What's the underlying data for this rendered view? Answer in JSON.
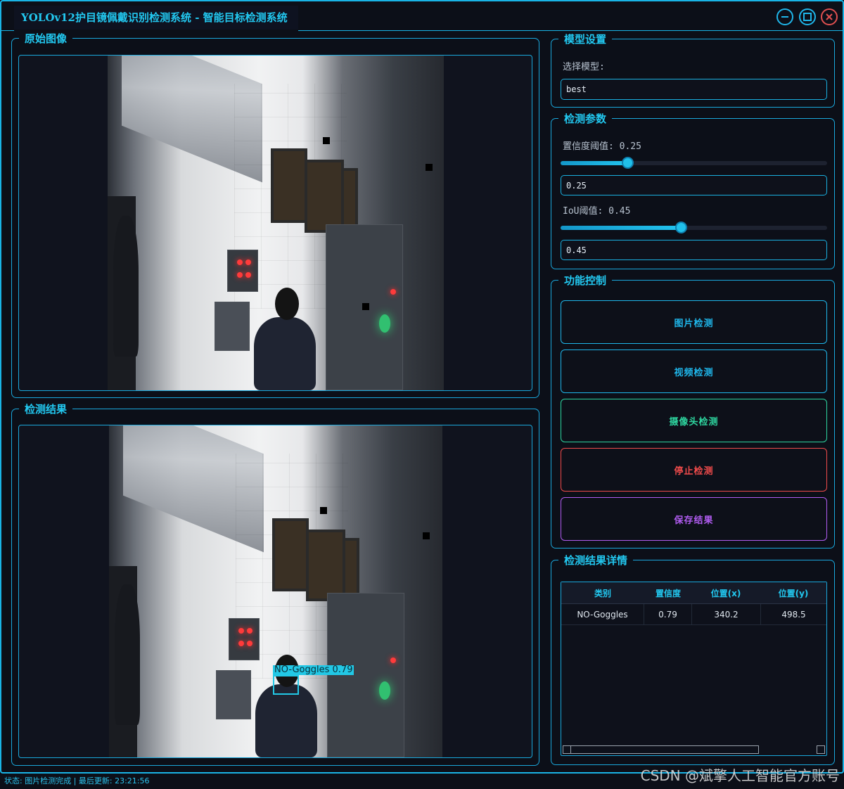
{
  "window": {
    "title": "YOLOv12护目镜佩戴识别检测系统 - 智能目标检测系统"
  },
  "original_panel": {
    "title": "原始图像"
  },
  "result_panel": {
    "title": "检测结果",
    "detection_label": "NO-Goggles 0.79"
  },
  "model_settings": {
    "title": "模型设置",
    "select_label": "选择模型:",
    "model_value": "best"
  },
  "detect_params": {
    "title": "检测参数",
    "conf_label": "置信度阈值: 0.25",
    "conf_value": "0.25",
    "conf_fraction": 0.25,
    "iou_label": "IoU阈值: 0.45",
    "iou_value": "0.45",
    "iou_fraction": 0.45
  },
  "controls": {
    "title": "功能控制",
    "image_detect": "图片检测",
    "video_detect": "视频检测",
    "camera_detect": "摄像头检测",
    "stop_detect": "停止检测",
    "save_result": "保存结果",
    "colors": {
      "image": "#1fb6ea",
      "video": "#1fb6ea",
      "camera": "#2ed6a0",
      "stop": "#ef4b4b",
      "save": "#b05cf0"
    }
  },
  "results_table": {
    "title": "检测结果详情",
    "headers": [
      "类别",
      "置信度",
      "位置(x)",
      "位置(y)"
    ],
    "rows": [
      [
        "NO-Goggles",
        "0.79",
        "340.2",
        "498.5"
      ]
    ]
  },
  "status": {
    "text": "状态: 图片检测完成 | 最后更新: 23:21:56"
  },
  "watermark": "CSDN @斌擎人工智能官方账号"
}
